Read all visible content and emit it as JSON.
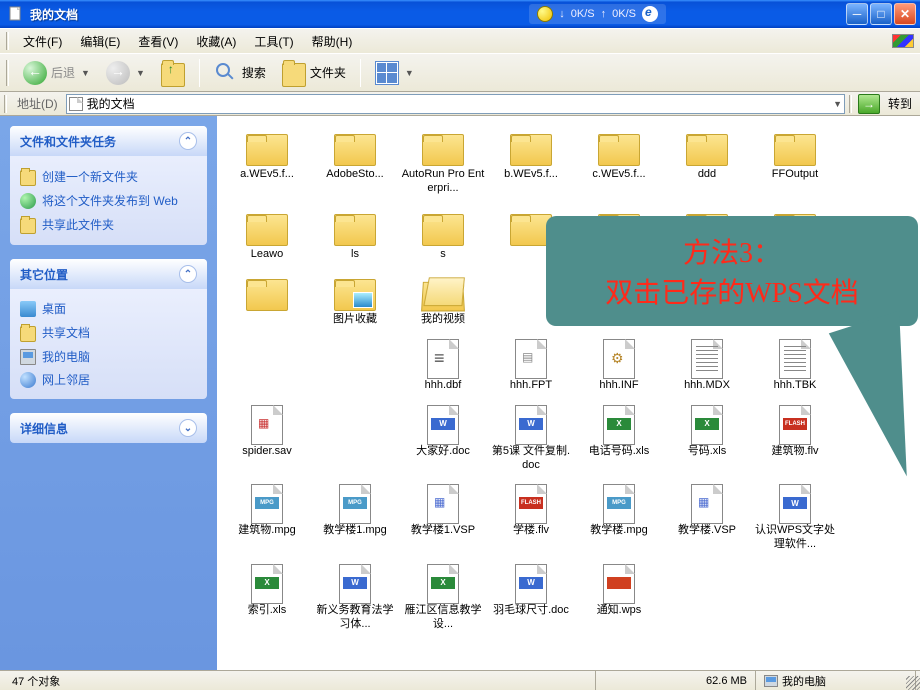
{
  "window": {
    "title": "我的文档",
    "net_down": "0K/S",
    "net_up": "0K/S"
  },
  "menubar": {
    "file": "文件(F)",
    "edit": "编辑(E)",
    "view": "查看(V)",
    "favorites": "收藏(A)",
    "tools": "工具(T)",
    "help": "帮助(H)"
  },
  "toolbar": {
    "back": "后退",
    "search": "搜索",
    "folders": "文件夹"
  },
  "addressbar": {
    "label": "地址(D)",
    "value": "我的文档",
    "go": "转到"
  },
  "sidepanel": {
    "tasks": {
      "title": "文件和文件夹任务",
      "items": [
        "创建一个新文件夹",
        "将这个文件夹发布到 Web",
        "共享此文件夹"
      ]
    },
    "places": {
      "title": "其它位置",
      "items": [
        "桌面",
        "共享文档",
        "我的电脑",
        "网上邻居"
      ]
    },
    "details": {
      "title": "详细信息"
    }
  },
  "files": [
    {
      "name": "a.WEv5.f...",
      "type": "folder"
    },
    {
      "name": "AdobeSto...",
      "type": "folder"
    },
    {
      "name": "AutoRun Pro Enterpri...",
      "type": "folder"
    },
    {
      "name": "b.WEv5.f...",
      "type": "folder"
    },
    {
      "name": "c.WEv5.f...",
      "type": "folder"
    },
    {
      "name": "ddd",
      "type": "folder"
    },
    {
      "name": "FFOutput",
      "type": "folder"
    },
    {
      "name": "Leawo",
      "type": "folder"
    },
    {
      "name": "ls",
      "type": "folder"
    },
    {
      "name": "s",
      "type": "folder"
    },
    {
      "name": "",
      "type": "folder"
    },
    {
      "name": "",
      "type": "folder"
    },
    {
      "name": "",
      "type": "folder"
    },
    {
      "name": "",
      "type": "folder"
    },
    {
      "name": "",
      "type": "folder"
    },
    {
      "name": "图片收藏",
      "type": "folder-pic"
    },
    {
      "name": "我的视频",
      "type": "folder-open"
    },
    {
      "name": "",
      "type": "hidden"
    },
    {
      "name": "",
      "type": "hidden"
    },
    {
      "name": "",
      "type": "hidden"
    },
    {
      "name": "",
      "type": "hidden"
    },
    {
      "name": "",
      "type": "hidden"
    },
    {
      "name": "",
      "type": "hidden"
    },
    {
      "name": "hhh.dbf",
      "type": "dbf"
    },
    {
      "name": "hhh.FPT",
      "type": "fpt"
    },
    {
      "name": "hhh.INF",
      "type": "inf"
    },
    {
      "name": "hhh.MDX",
      "type": "txt"
    },
    {
      "name": "hhh.TBK",
      "type": "txt"
    },
    {
      "name": "spider.sav",
      "type": "sav"
    },
    {
      "name": "",
      "type": "hidden"
    },
    {
      "name": "大家好.doc",
      "type": "word"
    },
    {
      "name": "第5课 文件复制.doc",
      "type": "word"
    },
    {
      "name": "电话号码.xls",
      "type": "xls"
    },
    {
      "name": "号码.xls",
      "type": "xls"
    },
    {
      "name": "建筑物.flv",
      "type": "flash"
    },
    {
      "name": "建筑物.mpg",
      "type": "mpg"
    },
    {
      "name": "教学楼1.mpg",
      "type": "mpg"
    },
    {
      "name": "教学楼1.VSP",
      "type": "vsp"
    },
    {
      "name": "学楼.flv",
      "type": "flash"
    },
    {
      "name": "教学楼.mpg",
      "type": "mpg"
    },
    {
      "name": "教学楼.VSP",
      "type": "vsp"
    },
    {
      "name": "认识WPS文字处理软件...",
      "type": "word"
    },
    {
      "name": "索引.xls",
      "type": "xls"
    },
    {
      "name": "新义务教育法学习体...",
      "type": "word"
    },
    {
      "name": "雁江区信息教学设...",
      "type": "xls"
    },
    {
      "name": "羽毛球尺寸.doc",
      "type": "word"
    },
    {
      "name": "通知.wps",
      "type": "wps"
    }
  ],
  "callout": {
    "line1": "方法3：",
    "line2_a": "双击已存的",
    "line2_b": "WPS",
    "line2_c": "文档"
  },
  "statusbar": {
    "count": "47 个对象",
    "size": "62.6 MB",
    "location": "我的电脑"
  }
}
